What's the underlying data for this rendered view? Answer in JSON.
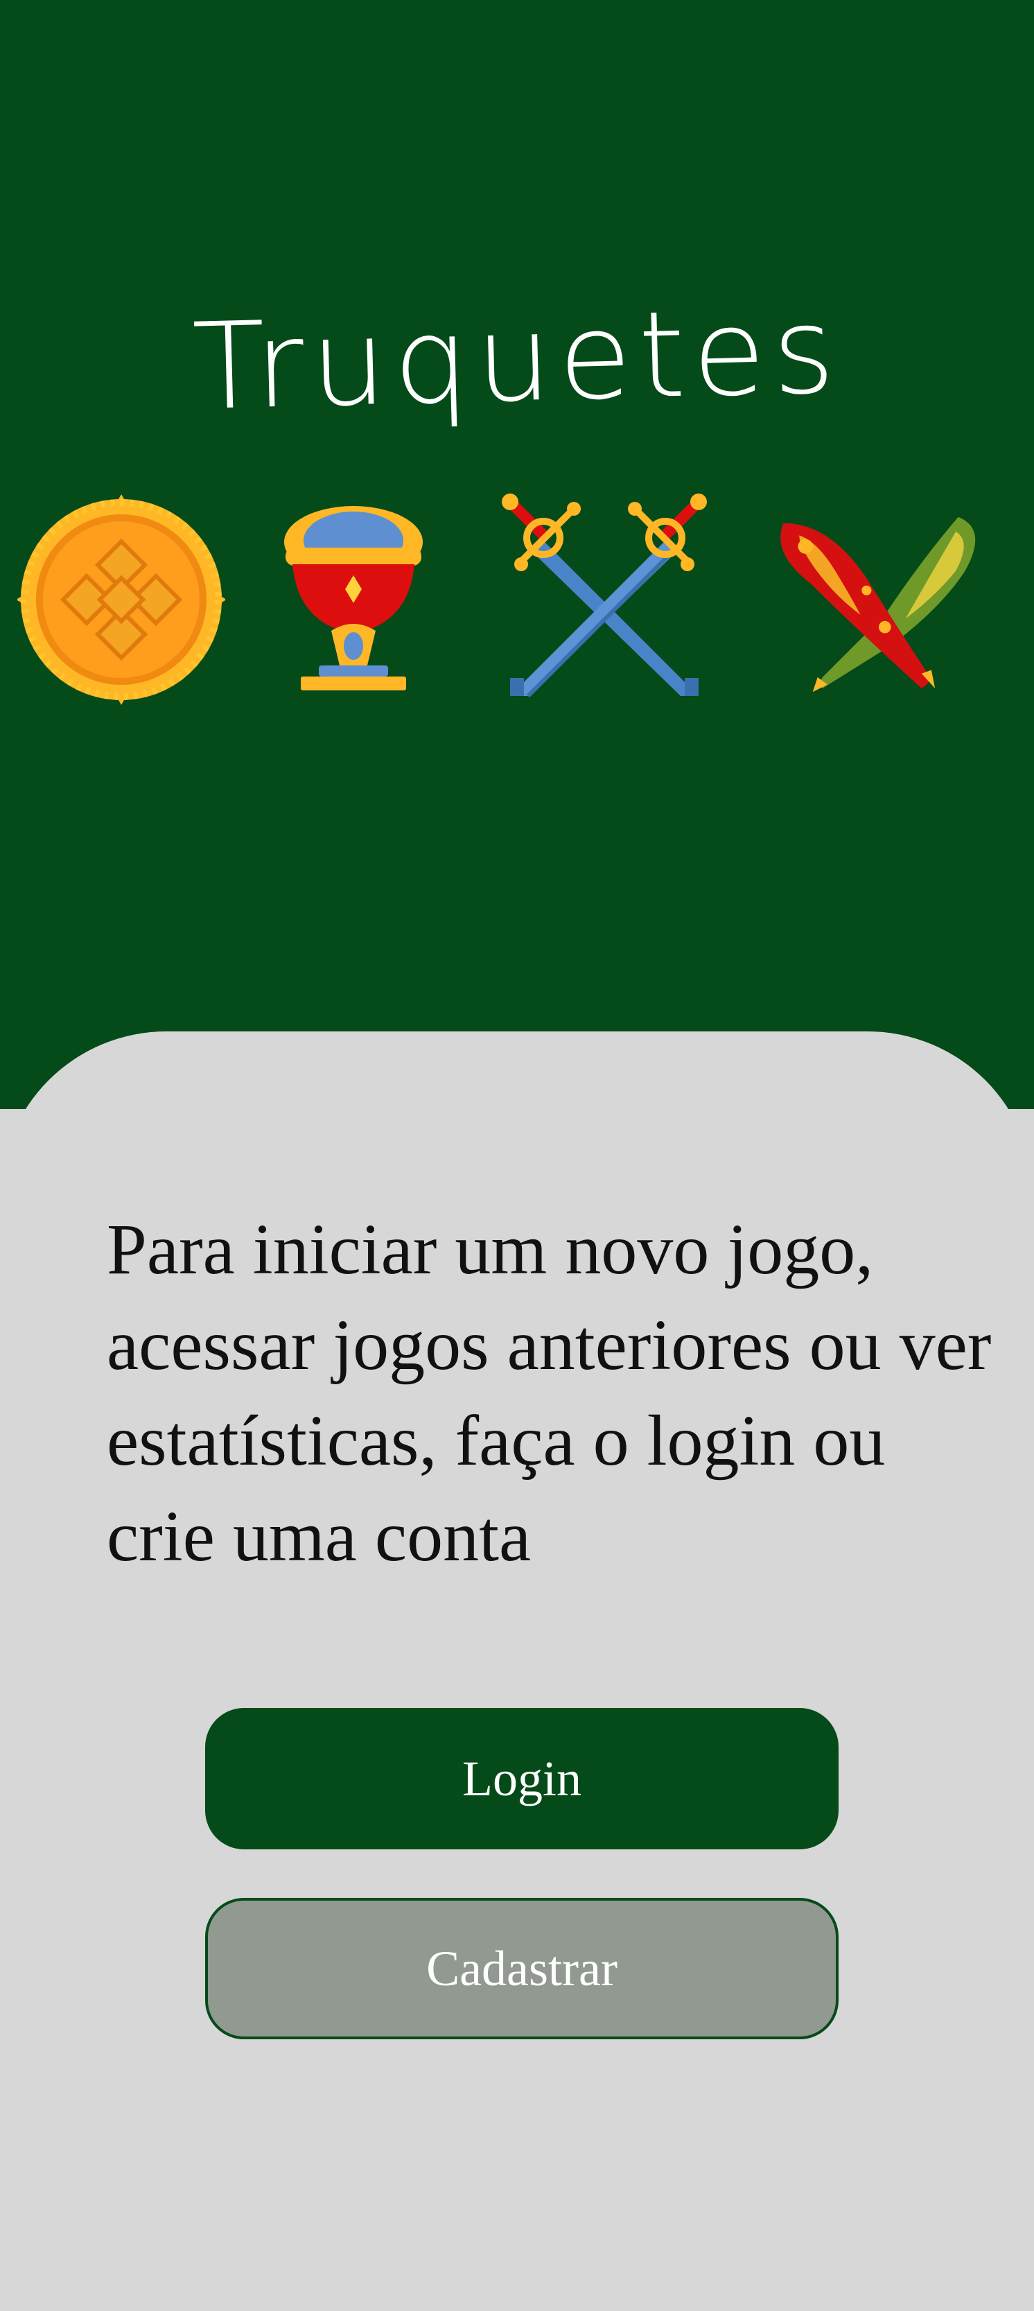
{
  "app": {
    "title": "Truquetes"
  },
  "suits": [
    "gold-coin-icon",
    "cup-icon",
    "crossed-swords-icon",
    "crossed-clubs-icon"
  ],
  "auth": {
    "message": "Para iniciar um novo jogo, acessar jogos anteriores ou ver estatísticas, faça o login ou crie uma conta",
    "login_label": "Login",
    "signup_label": "Cadastrar"
  },
  "colors": {
    "primary_green": "#054b19",
    "sheet_background": "#d7d7d7",
    "secondary_button": "#919991",
    "text_dark": "#111111",
    "text_light": "#ffffff"
  }
}
